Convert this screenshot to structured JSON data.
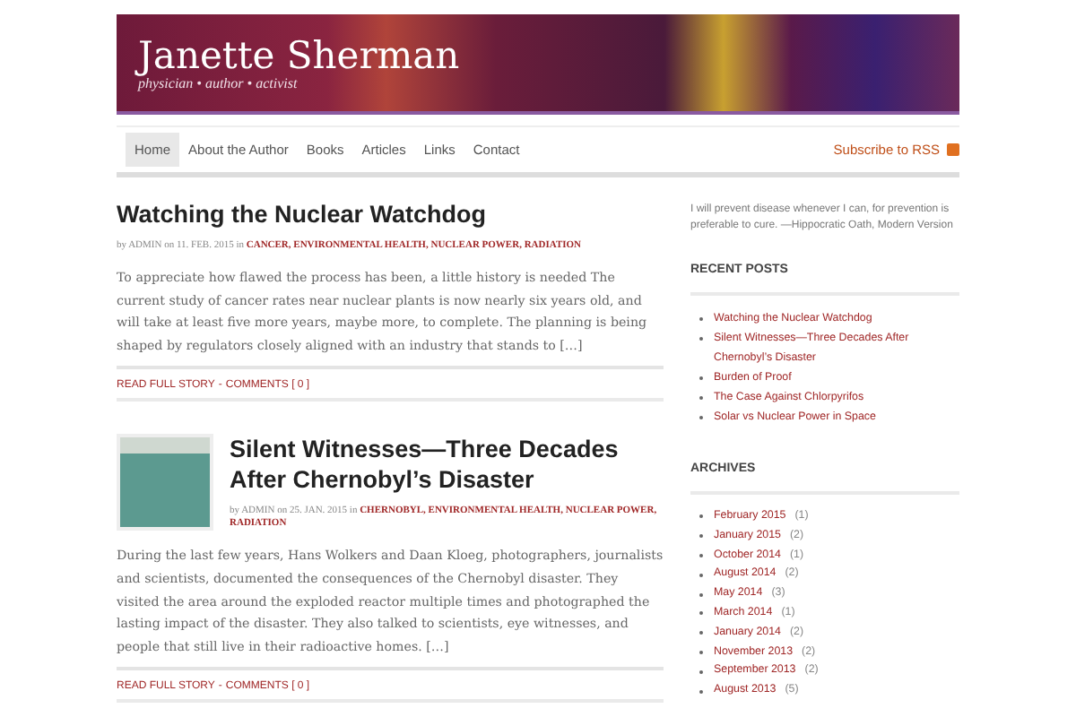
{
  "header": {
    "title": "Janette Sherman",
    "tagline": "physician • author • activist"
  },
  "nav": {
    "items": [
      {
        "label": "Home",
        "selected": true
      },
      {
        "label": "About the Author",
        "selected": false
      },
      {
        "label": "Books",
        "selected": false
      },
      {
        "label": "Articles",
        "selected": false
      },
      {
        "label": "Links",
        "selected": false
      },
      {
        "label": "Contact",
        "selected": false
      }
    ],
    "rss": "Subscribe to RSS"
  },
  "posts": [
    {
      "title": "Watching the Nuclear Watchdog",
      "has_thumbnail": false,
      "meta": "by ADMIN on 11. FEB. 2015 in",
      "categories": [
        "CANCER,",
        "ENVIRONMENTAL HEALTH,",
        "NUCLEAR POWER,",
        "RADIATION"
      ],
      "excerpt": "To appreciate how flawed the process has been, a little history is needed The current study of cancer rates near nuclear plants is now nearly six years old, and will take at least five more years, maybe more, to complete. The planning is being shaped by regulators closely aligned with an industry that stands to […]",
      "read_more": "READ FULL STORY",
      "separator": "-",
      "comments": "COMMENTS [ 0 ]"
    },
    {
      "title": "Silent Witnesses—Three Decades After Chernobyl’s Disaster",
      "has_thumbnail": true,
      "meta": "by ADMIN on 25. JAN. 2015 in",
      "categories": [
        "CHERNOBYL,",
        "ENVIRONMENTAL HEALTH,",
        "NUCLEAR POWER,",
        "RADIATION"
      ],
      "excerpt": "During the last few years, Hans Wolkers and Daan Kloeg, photographers, journalists and scientists, documented the consequences of the Chernobyl disaster. They visited the area around the exploded reactor multiple times and photographed the lasting impact of the disaster. They also talked to scientists, eye witnesses, and people that still live in their radioactive homes. […]",
      "read_more": "READ FULL STORY",
      "separator": "-",
      "comments": "COMMENTS [ 0 ]"
    }
  ],
  "sidebar": {
    "quote": "I will prevent disease whenever I can, for prevention is preferable to cure. —Hippocratic Oath, Modern Version",
    "recent_posts": {
      "heading": "RECENT POSTS",
      "items": [
        "Watching the Nuclear Watchdog",
        "Silent Witnesses—Three Decades After Chernobyl’s Disaster",
        "Burden of Proof",
        "The Case Against Chlorpyrifos",
        "Solar vs Nuclear Power in Space"
      ]
    },
    "archives": {
      "heading": "ARCHIVES",
      "items": [
        {
          "label": "February 2015",
          "count": "(1)"
        },
        {
          "label": "January 2015",
          "count": "(2)"
        },
        {
          "label": "October 2014",
          "count": "(1)"
        },
        {
          "label": "August 2014",
          "count": "(2)"
        },
        {
          "label": "May 2014",
          "count": "(3)"
        },
        {
          "label": "March 2014",
          "count": "(1)"
        },
        {
          "label": "January 2014",
          "count": "(2)"
        },
        {
          "label": "November 2013",
          "count": "(2)"
        },
        {
          "label": "September 2013",
          "count": "(2)"
        },
        {
          "label": "August 2013",
          "count": "(5)"
        }
      ]
    }
  }
}
